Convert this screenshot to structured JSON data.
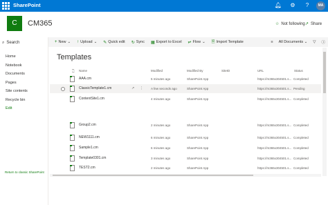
{
  "suitebar": {
    "app_name": "SharePoint",
    "user_initials": "MA",
    "icons": [
      "bell-icon",
      "gear-icon",
      "help-icon"
    ]
  },
  "site": {
    "logo_letter": "C",
    "name": "CM365",
    "follow_label": "Not following",
    "share_label": "Share"
  },
  "nav": {
    "search_label": "Search",
    "items": [
      {
        "label": "Home"
      },
      {
        "label": "Notebook"
      },
      {
        "label": "Documents"
      },
      {
        "label": "Pages"
      },
      {
        "label": "Site contents"
      },
      {
        "label": "Recycle bin"
      },
      {
        "label": "Edit"
      }
    ],
    "return_classic": "Return to classic SharePoint"
  },
  "commands": {
    "new": "New",
    "upload": "Upload",
    "quick_edit": "Quick edit",
    "sync": "Sync",
    "export": "Export to Excel",
    "flow": "Flow",
    "import_template": "Import Template",
    "view": "All Documents"
  },
  "library": {
    "title": "Templates",
    "columns": {
      "name": "Name",
      "modified": "Modified",
      "modified_by": "Modified By",
      "siteid": "SiteID",
      "url": "URL",
      "status": "Status"
    },
    "rows": [
      {
        "name": "AAA.cm",
        "modified": "5 minutes ago",
        "modified_by": "SharePoint App",
        "url": "https://m365x304501.s...",
        "status": "Completed"
      },
      {
        "name": "ClassicTemplate1.cm",
        "modified": "A few seconds ago",
        "modified_by": "SharePoint App",
        "url": "https://m365x304501.s...",
        "status": "Pending"
      },
      {
        "name": "ContentSite1.cm",
        "modified": "4 minutes ago",
        "modified_by": "SharePoint App",
        "url": "https://m365x304501.s...",
        "status": "Completed"
      },
      {
        "name": "Group2.cm",
        "modified": "2 minutes ago",
        "modified_by": "SharePoint App",
        "url": "https://m365x304501.s...",
        "status": "Completed"
      },
      {
        "name": "NEW1111.cm",
        "modified": "6 minutes ago",
        "modified_by": "SharePoint App",
        "url": "https://m365x304501.s...",
        "status": "Completed"
      },
      {
        "name": "Sample1.cm",
        "modified": "6 minutes ago",
        "modified_by": "SharePoint App",
        "url": "https://m365x304501.s...",
        "status": "Completed"
      },
      {
        "name": "Template0301.cm",
        "modified": "3 minutes ago",
        "modified_by": "SharePoint App",
        "url": "https://m365x304501.s...",
        "status": "Completed"
      },
      {
        "name": "TEST2.cm",
        "modified": "2 minutes ago",
        "modified_by": "SharePoint App",
        "url": "https://m365x304501.s...",
        "status": "Completed"
      }
    ]
  },
  "colors": {
    "suitebar": "#0078d4",
    "accent": "#107c10"
  }
}
